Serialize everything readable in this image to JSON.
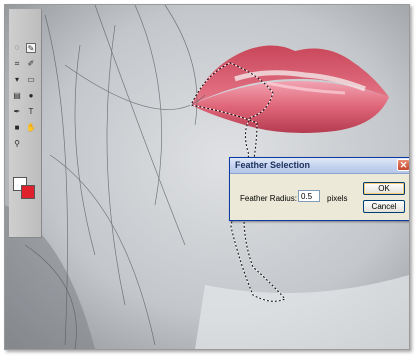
{
  "dialog": {
    "title": "Feather Selection",
    "close_symbol": "✕",
    "radius_label": "Feather Radius:",
    "radius_value": "0.5",
    "units": "pixels",
    "ok_label": "OK",
    "cancel_label": "Cancel"
  },
  "toolbar": {
    "tools": [
      "lasso-icon",
      "magic-wand-icon",
      "crop-icon",
      "brush-icon",
      "stamp-icon",
      "eraser-icon",
      "gradient-icon",
      "dodge-icon",
      "pen-icon",
      "type-icon",
      "shape-icon",
      "hand-icon",
      "zoom-icon"
    ],
    "foreground_color": "#ffffff",
    "background_color": "#e0202a"
  },
  "colors": {
    "accent_titlebar": "#c4d3ee",
    "lips": "#d4505f",
    "skin": "#c9ccd0"
  }
}
